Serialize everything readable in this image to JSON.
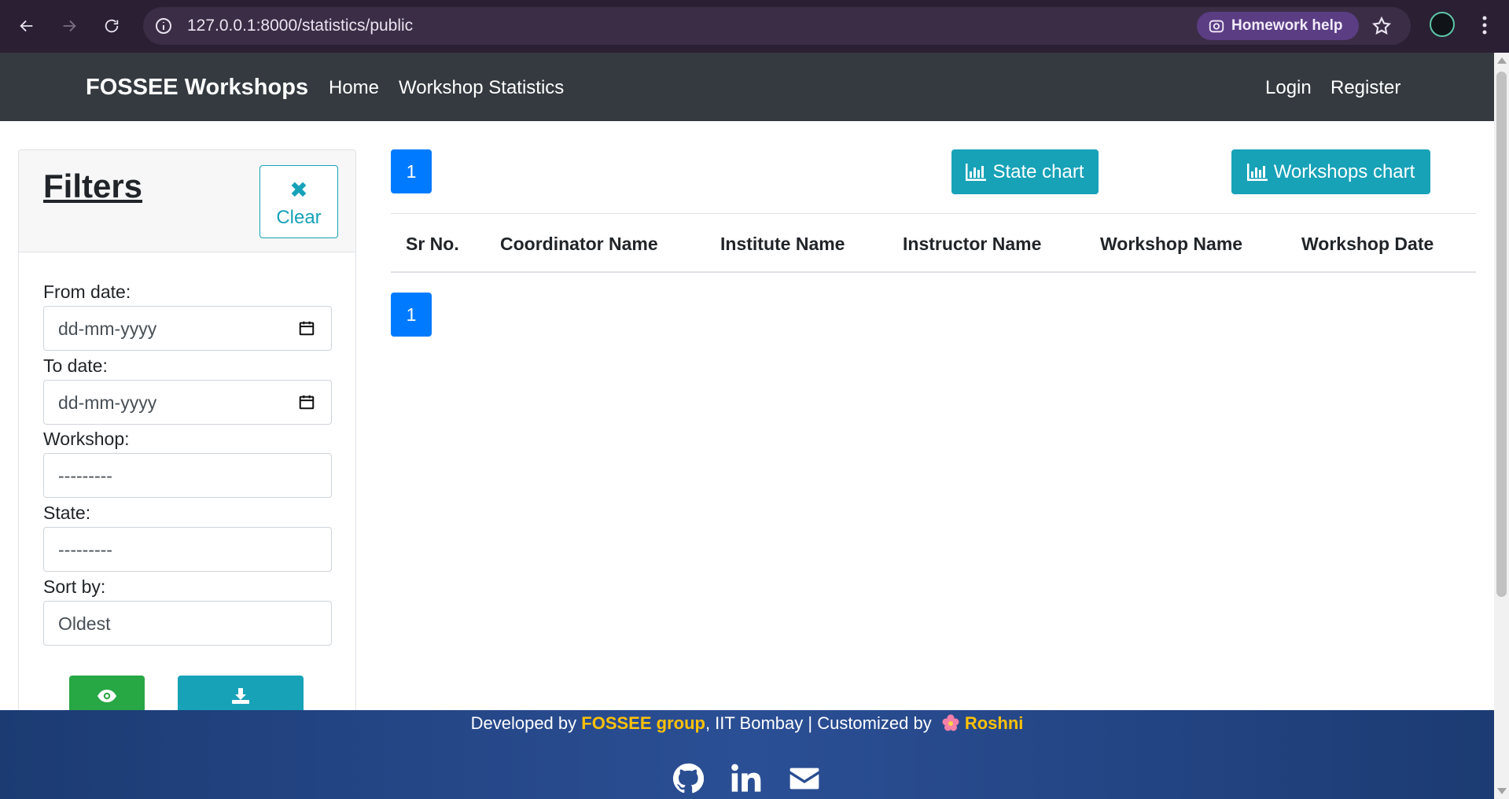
{
  "browser": {
    "url": "127.0.0.1:8000/statistics/public",
    "homework_chip": "Homework help",
    "icons": [
      "back-arrow-icon",
      "forward-arrow-icon",
      "reload-icon",
      "info-icon",
      "lens-icon",
      "star-icon",
      "kebab-menu-icon"
    ]
  },
  "navbar": {
    "brand": "FOSSEE Workshops",
    "links": [
      "Home",
      "Workshop Statistics"
    ],
    "right_links": [
      "Login",
      "Register"
    ]
  },
  "filters": {
    "title": "Filters",
    "clear_label": "Clear",
    "from_date_label": "From date:",
    "from_date_placeholder": "dd-mm-yyyy",
    "to_date_label": "To date:",
    "to_date_placeholder": "dd-mm-yyyy",
    "workshop_label": "Workshop:",
    "workshop_value": "---------",
    "state_label": "State:",
    "state_value": "---------",
    "sort_label": "Sort by:",
    "sort_value": "Oldest"
  },
  "main": {
    "page_number": "1",
    "state_chart_label": "State chart",
    "workshops_chart_label": "Workshops chart",
    "table_headers": [
      "Sr No.",
      "Coordinator Name",
      "Institute Name",
      "Instructor Name",
      "Workshop Name",
      "Workshop Date"
    ],
    "bottom_page_number": "1"
  },
  "footer": {
    "developed_by": "Developed by ",
    "group": "FOSSEE group",
    "iit": ", IIT Bombay | Customized by ",
    "author": "Roshni",
    "icons": [
      "github-icon",
      "linkedin-icon",
      "mail-icon"
    ]
  },
  "colors": {
    "navbar": "#343a40",
    "primary": "#007bff",
    "info": "#17a2b8",
    "success": "#28a745",
    "footer": "#2b4f95",
    "highlight": "#ffc107"
  }
}
